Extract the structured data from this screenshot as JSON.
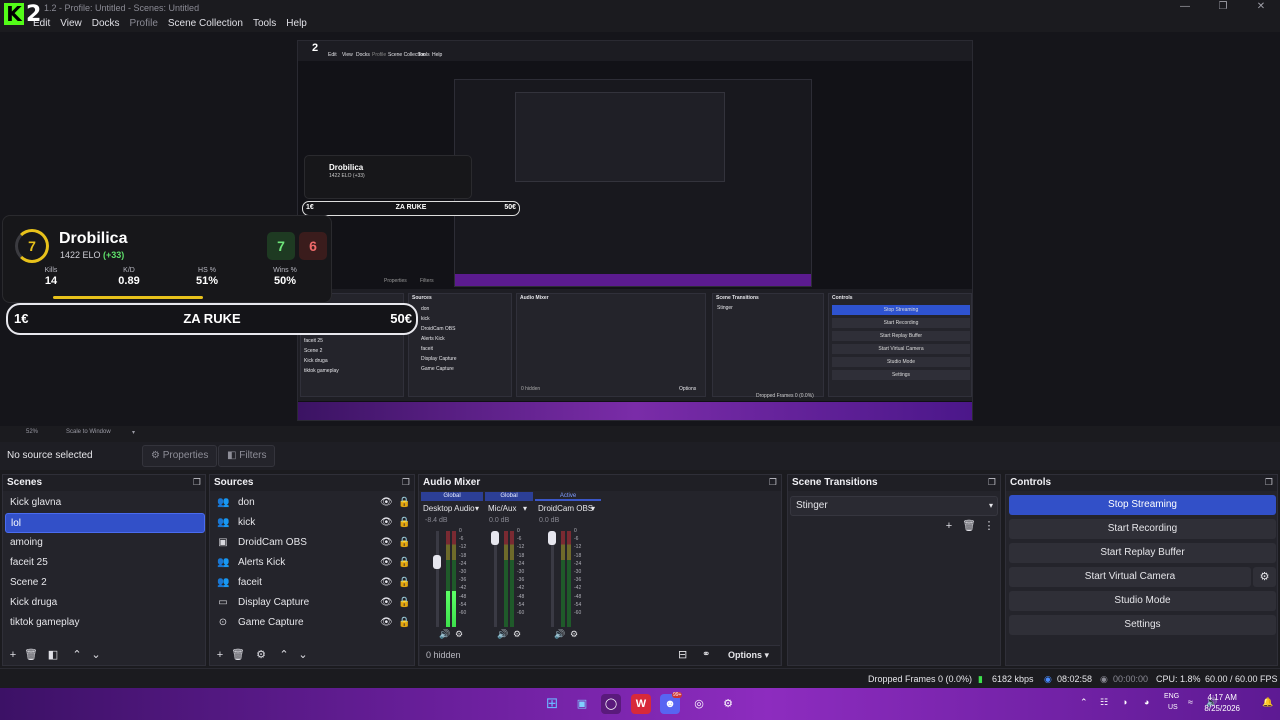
{
  "window": {
    "title": "OBS 31.1.2 - Profile: Untitled - Scenes: Untitled",
    "title_visible": "1.2 - Profile: Untitled - Scenes: Untitled",
    "controls": [
      "—",
      "❐",
      "✕"
    ]
  },
  "logo": {
    "k": "K",
    "n": "2"
  },
  "menu": [
    "File",
    "Edit",
    "View",
    "Docks",
    "Profile",
    "Scene Collection",
    "Tools",
    "Help"
  ],
  "hud": {
    "level": "7",
    "name": "Drobilica",
    "elo": "1422 ELO",
    "elo_delta": "(+33)",
    "wins_badge": "7",
    "losses_badge": "6",
    "stats": [
      {
        "label": "Kills",
        "value": "14"
      },
      {
        "label": "K/D",
        "value": "0.89"
      },
      {
        "label": "HS %",
        "value": "51%"
      },
      {
        "label": "Wins %",
        "value": "50%"
      }
    ],
    "bet_left": "1€",
    "bet_center": "ZA RUKE",
    "bet_right": "50€"
  },
  "nested": {
    "logo": "2",
    "menu": [
      "Edit",
      "View",
      "Docks",
      "Profile",
      "Scene Collection",
      "Tools",
      "Help"
    ],
    "hud_name": "Drobilica",
    "hud_elo": "1422 ELO (+33)",
    "bet_left": "1€",
    "bet_center": "ZA RUKE",
    "bet_right": "50€",
    "tabs": [
      "Properties",
      "Filters"
    ],
    "panels": [
      "Sources",
      "Audio Mixer",
      "Scene Transitions",
      "Controls"
    ],
    "scenes": [
      "amoing",
      "faceit 25",
      "Scene 2",
      "Kick druga",
      "tiktok gameplay"
    ],
    "sources": [
      "don",
      "kick",
      "DroidCam OBS",
      "Alerts Kick",
      "faceit",
      "Display Capture",
      "Game Capture"
    ],
    "controls": [
      "Stop Streaming",
      "Start Recording",
      "Start Replay Buffer",
      "Start Virtual Camera",
      "Studio Mode",
      "Settings"
    ],
    "transition": "Stinger",
    "mixer_hidden": "0 hidden",
    "mixer_options": "Options",
    "status": "Dropped Frames 0 (0.0%)"
  },
  "scalebar": {
    "zoom": "52%",
    "mode": "Scale to Window"
  },
  "props": {
    "no_source": "No source selected",
    "properties": "Properties",
    "filters": "Filters"
  },
  "scenes": {
    "title": "Scenes",
    "items": [
      "Kick glavna",
      "lol",
      "amoing",
      "faceit 25",
      "Scene 2",
      "Kick druga",
      "tiktok gameplay"
    ],
    "selected": 1
  },
  "sources": {
    "title": "Sources",
    "items": [
      {
        "icon": "person-icon",
        "glyph": "👥",
        "label": "don"
      },
      {
        "icon": "person-icon",
        "glyph": "👥",
        "label": "kick"
      },
      {
        "icon": "camera-icon",
        "glyph": "▣",
        "label": "DroidCam OBS"
      },
      {
        "icon": "person-icon",
        "glyph": "👥",
        "label": "Alerts Kick"
      },
      {
        "icon": "person-icon",
        "glyph": "👥",
        "label": "faceit"
      },
      {
        "icon": "monitor-icon",
        "glyph": "▭",
        "label": "Display Capture"
      },
      {
        "icon": "gamepad-icon",
        "glyph": "⊙",
        "label": "Game Capture"
      }
    ]
  },
  "mixer": {
    "title": "Audio Mixer",
    "channels": [
      {
        "tag": "Global",
        "name": "Desktop Audio",
        "db": "-8.4 dB",
        "level": 0.38
      },
      {
        "tag": "Global",
        "name": "Mic/Aux",
        "db": "0.0 dB",
        "level": 0.0
      },
      {
        "tag": "Active",
        "name": "DroidCam OBS",
        "db": "0.0 dB",
        "level": 0.0
      }
    ],
    "scale": [
      "0",
      "-6",
      "-12",
      "-18",
      "-24",
      "-30",
      "-36",
      "-42",
      "-48",
      "-54",
      "-60"
    ],
    "hidden": "0 hidden",
    "options": "Options"
  },
  "transitions": {
    "title": "Scene Transitions",
    "selected": "Stinger"
  },
  "controls": {
    "title": "Controls",
    "buttons": [
      "Stop Streaming",
      "Start Recording",
      "Start Replay Buffer",
      "Start Virtual Camera",
      "Studio Mode",
      "Settings"
    ]
  },
  "status": {
    "dropped": "Dropped Frames 0 (0.0%)",
    "bitrate": "6182 kbps",
    "stream_time": "08:02:58",
    "rec_time": "00:00:00",
    "cpu": "CPU: 1.8%",
    "fps": "60.00 / 60.00 FPS"
  },
  "taskbar": {
    "lang_top": "ENG",
    "lang_bottom": "US",
    "time": "4:17 AM",
    "date": "8/25/2026",
    "badge": "99+"
  },
  "colors": {
    "accent": "#3250c8",
    "kick_green": "#53fc18",
    "taskbar": "#6a1f9c"
  }
}
